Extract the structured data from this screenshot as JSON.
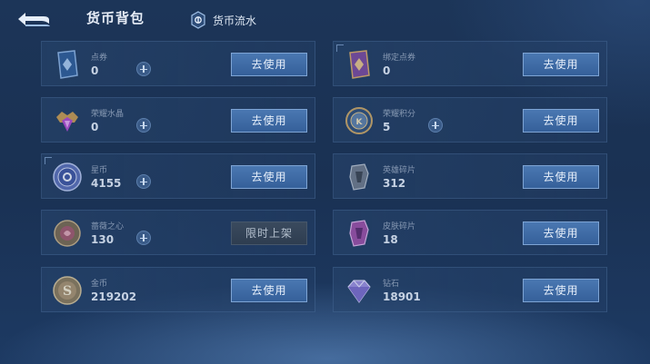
{
  "header": {
    "title": "货币背包",
    "flow_label": "货币流水"
  },
  "currencies": [
    {
      "name": "点券",
      "amount": "0",
      "button": "去使用",
      "icon": "coupon-card-icon"
    },
    {
      "name": "绑定点券",
      "amount": "0",
      "button": "去使用",
      "icon": "bound-coupon-card-icon"
    },
    {
      "name": "荣耀水晶",
      "amount": "0",
      "button": "去使用",
      "icon": "glory-crystal-icon"
    },
    {
      "name": "荣耀积分",
      "amount": "5",
      "button": "去使用",
      "icon": "glory-points-icon"
    },
    {
      "name": "星币",
      "amount": "4155",
      "button": "去使用",
      "icon": "star-coin-icon"
    },
    {
      "name": "英雄碎片",
      "amount": "312",
      "button": "去使用",
      "icon": "hero-fragment-icon"
    },
    {
      "name": "蔷薇之心",
      "amount": "130",
      "button": "限时上架",
      "icon": "rose-heart-icon"
    },
    {
      "name": "皮肤碎片",
      "amount": "18",
      "button": "去使用",
      "icon": "skin-fragment-icon"
    },
    {
      "name": "金币",
      "amount": "219202",
      "button": "去使用",
      "icon": "gold-coin-icon"
    },
    {
      "name": "钻石",
      "amount": "18901",
      "button": "去使用",
      "icon": "diamond-icon"
    }
  ],
  "colors": {
    "button": "#3e6aa6",
    "background": "#1b3356",
    "disabled_button": "#34445a"
  }
}
